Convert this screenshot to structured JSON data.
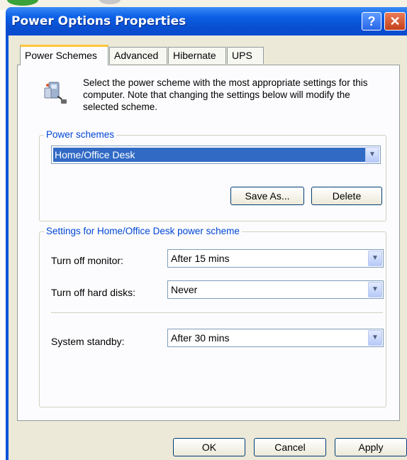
{
  "window": {
    "title": "Power Options Properties",
    "help_glyph": "?",
    "close_glyph": "✕"
  },
  "tabs": [
    {
      "label": "Power Schemes",
      "selected": true
    },
    {
      "label": "Advanced",
      "selected": false
    },
    {
      "label": "Hibernate",
      "selected": false
    },
    {
      "label": "UPS",
      "selected": false
    }
  ],
  "intro": {
    "icon": "power-scheme-icon",
    "text": "Select the power scheme with the most appropriate settings for this computer. Note that changing the settings below will modify the selected scheme."
  },
  "schemes": {
    "group_label": "Power schemes",
    "selected": "Home/Office Desk",
    "save_as_label": "Save As...",
    "delete_label": "Delete"
  },
  "settings": {
    "group_label": "Settings for Home/Office Desk power scheme",
    "monitor_label": "Turn off monitor:",
    "monitor_value": "After 15 mins",
    "disks_label": "Turn off hard disks:",
    "disks_value": "Never",
    "standby_label": "System standby:",
    "standby_value": "After 30 mins"
  },
  "footer": {
    "ok_label": "OK",
    "cancel_label": "Cancel",
    "apply_label": "Apply"
  },
  "colors": {
    "titlebar": "#0a4fd0",
    "client": "#ece9d8",
    "group_label": "#0046d5",
    "selection": "#316ac5",
    "active_tab_accent": "#ffc83c"
  }
}
